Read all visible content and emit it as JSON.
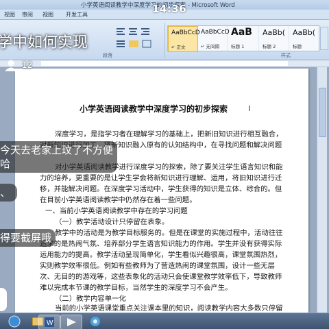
{
  "window": {
    "title": "小学英语阅读教学中深度学习的初步探索 - Microsoft Word"
  },
  "status": {
    "clock": "14:36"
  },
  "ribbon": {
    "tabs": [
      "视图",
      "审阅",
      "视图",
      "开发工具"
    ],
    "group_labels": [
      "段落",
      "样式"
    ],
    "styles": [
      {
        "sample": "AaBbCcD",
        "name": "↵ 正文"
      },
      {
        "sample": "AaBbCcD",
        "name": "↵ 无间隔"
      },
      {
        "sample": "AaB",
        "name": "标题 1"
      },
      {
        "sample": "AaBb(",
        "name": "标题 2"
      },
      {
        "sample": "AaBb(",
        "name": "标题"
      }
    ]
  },
  "document": {
    "title": "小学英语阅读教学中深度学习的初步探索",
    "lines": [
      "深度学习，是指学习者在理解学习的基础上，把新旧知识进行相互融合，",
      "对新知识进行加工，将新知识融入原有的认知结构中，在寻找问题和解决问题",
      "",
      "对小学英语阅读教学进行深度学习的探索，除了要关注学生语言知识和能",
      "力的培养，更重要的是让学生学会将新知识进行理解、运用，将旧知识进行迁",
      "移，并能解决问题。在深度学习活动中，学生获得的知识是立体、综合的。但",
      "在目前小学英语阅读教学中仍然存在着一些问题。",
      "一、当前小学英语阅读教学中存在的学习问题",
      "（一）教学活动设计只停留在表象。",
      "教学中的活动是为教学目标服务的。但是在课堂的实施过程中，活动往往",
      "追求的是热闹气氛、培养部分学生语言知识能力的作用。学生并没有获得实际",
      "运用能力的提高。教学活动呈现简单化，学生看似兴趣很高，课堂氛围热烈，",
      "实则教学效率很低。例如有些教师为了营造热闹的课堂氛围，设计一些无层",
      "次、无目的的游戏等，这些表象化的活动只会使课堂教学效率低下，导致教师",
      "难以完成本节课的教学目标，当然学生的深度学习不会产生。",
      "（二）教学内容单一化",
      "当前的小学英语课堂重点关注课本里的知识，阅读教学内容大多数只停留"
    ]
  },
  "overlay": {
    "post_title": "学中如何实现",
    "author_count": "12",
    "comments": [
      "今天去老家上玟了不方便",
      "哈",
      "、",
      "得要截屏哦"
    ]
  },
  "taskbar": {
    "items": [
      "start-orb",
      "word-icon",
      "media-icon",
      "browser-icon"
    ]
  },
  "colors": {
    "ribbon": "#c7d9ef",
    "selected_style": "#fbe6a6",
    "taskbar": "#3d526e"
  }
}
